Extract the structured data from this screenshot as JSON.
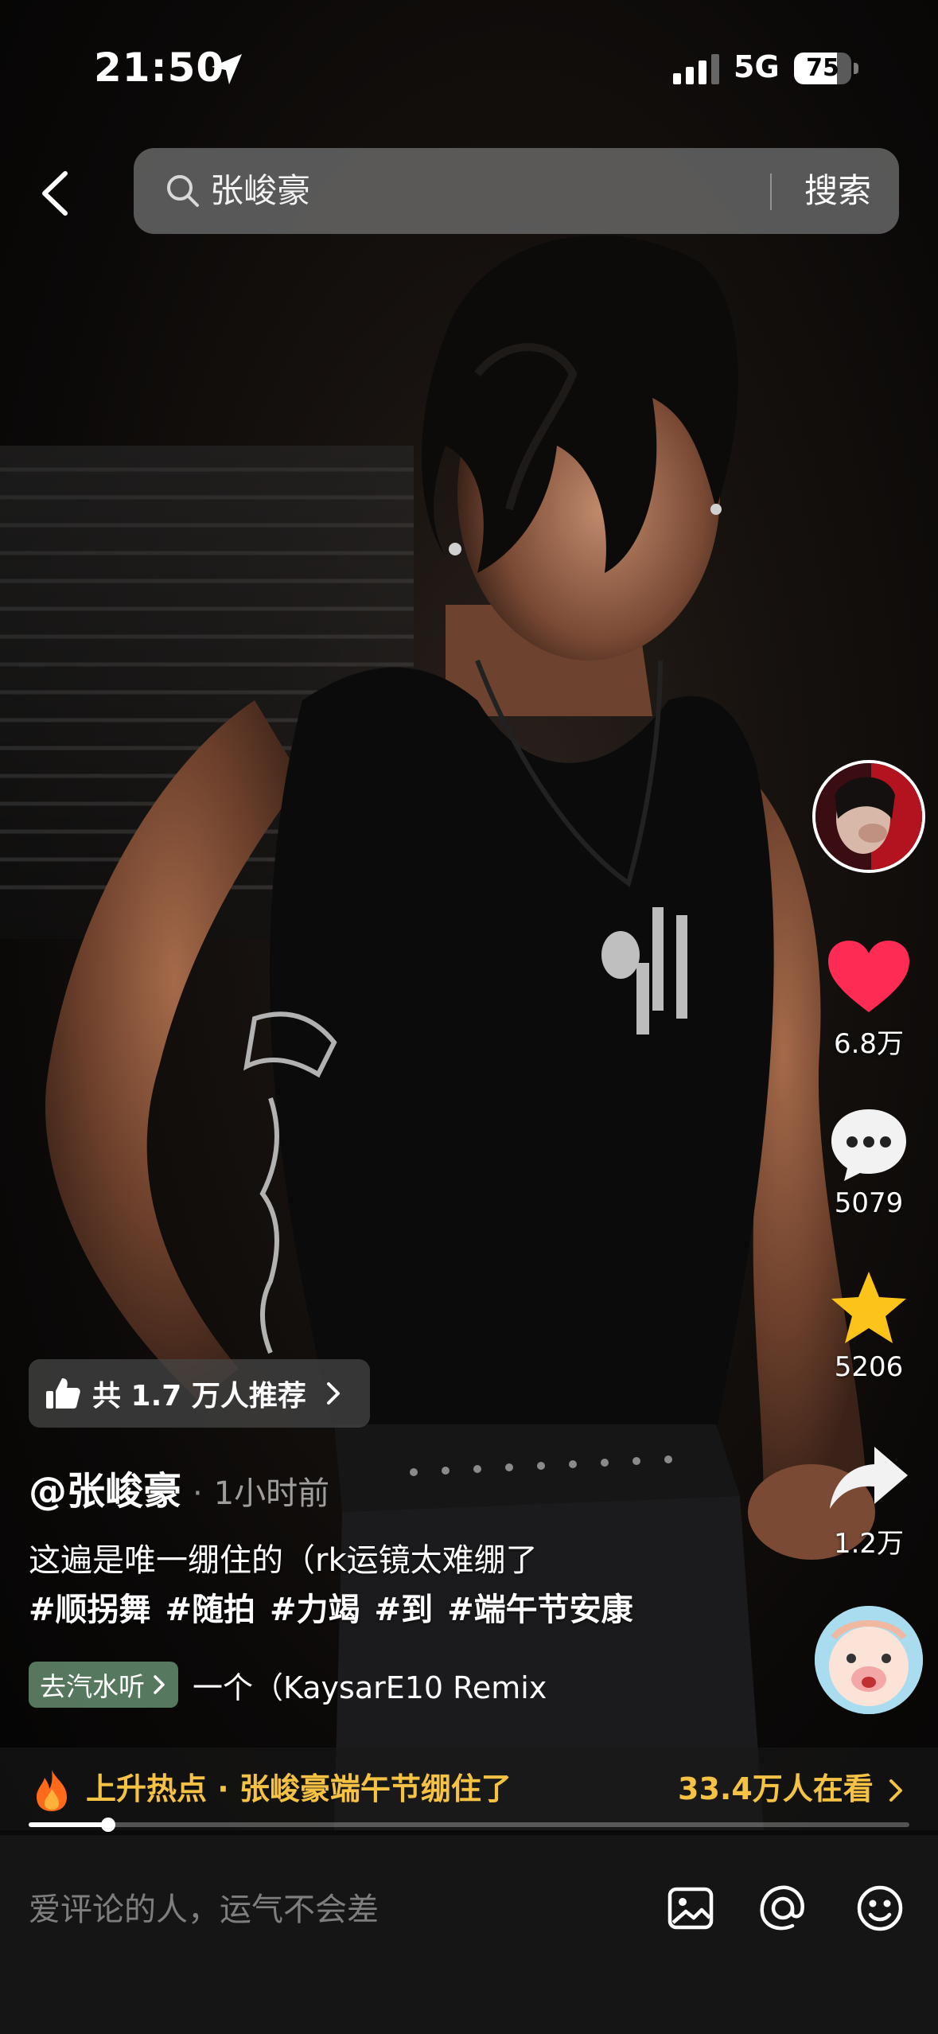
{
  "status_bar": {
    "time": "21:50",
    "network": "5G",
    "battery": "75",
    "battery_level_percent": 75
  },
  "search": {
    "query": "张峻豪",
    "submit_label": "搜索"
  },
  "actions": {
    "likes": "6.8万",
    "comments": "5079",
    "favorites": "5206",
    "shares": "1.2万"
  },
  "recommend": {
    "label": "共 1.7 万人推荐"
  },
  "post": {
    "author": "@张峻豪",
    "separator": "·",
    "time_ago": "1小时前",
    "caption": "这遍是唯一绷住的（rk运镜太难绷了",
    "hashtags": [
      "#顺拐舞",
      "#随拍",
      "#力竭",
      "#到",
      "#端午节安康"
    ]
  },
  "music": {
    "chip_label": "去汽水听",
    "title": "一个（KaysarE10 Remix"
  },
  "hot_topic": {
    "label": "上升热点 · 张峻豪端午节绷住了",
    "viewers": "33.4万人在看"
  },
  "progress": {
    "played_fraction": 0.09
  },
  "comment_bar": {
    "placeholder": "爱评论的人，运气不会差"
  },
  "colors": {
    "like_red": "#fe2c55",
    "favorite_yellow": "#fcc419",
    "hot_text_yellow": "#f6c244"
  },
  "icons": [
    "location-arrow-icon",
    "signal-icon",
    "battery-icon",
    "back-icon",
    "search-icon",
    "heart-icon",
    "comment-icon",
    "star-icon",
    "share-icon",
    "thumbs-up-icon",
    "chevron-right-icon",
    "fire-icon",
    "image-icon",
    "at-icon",
    "emoji-icon"
  ]
}
